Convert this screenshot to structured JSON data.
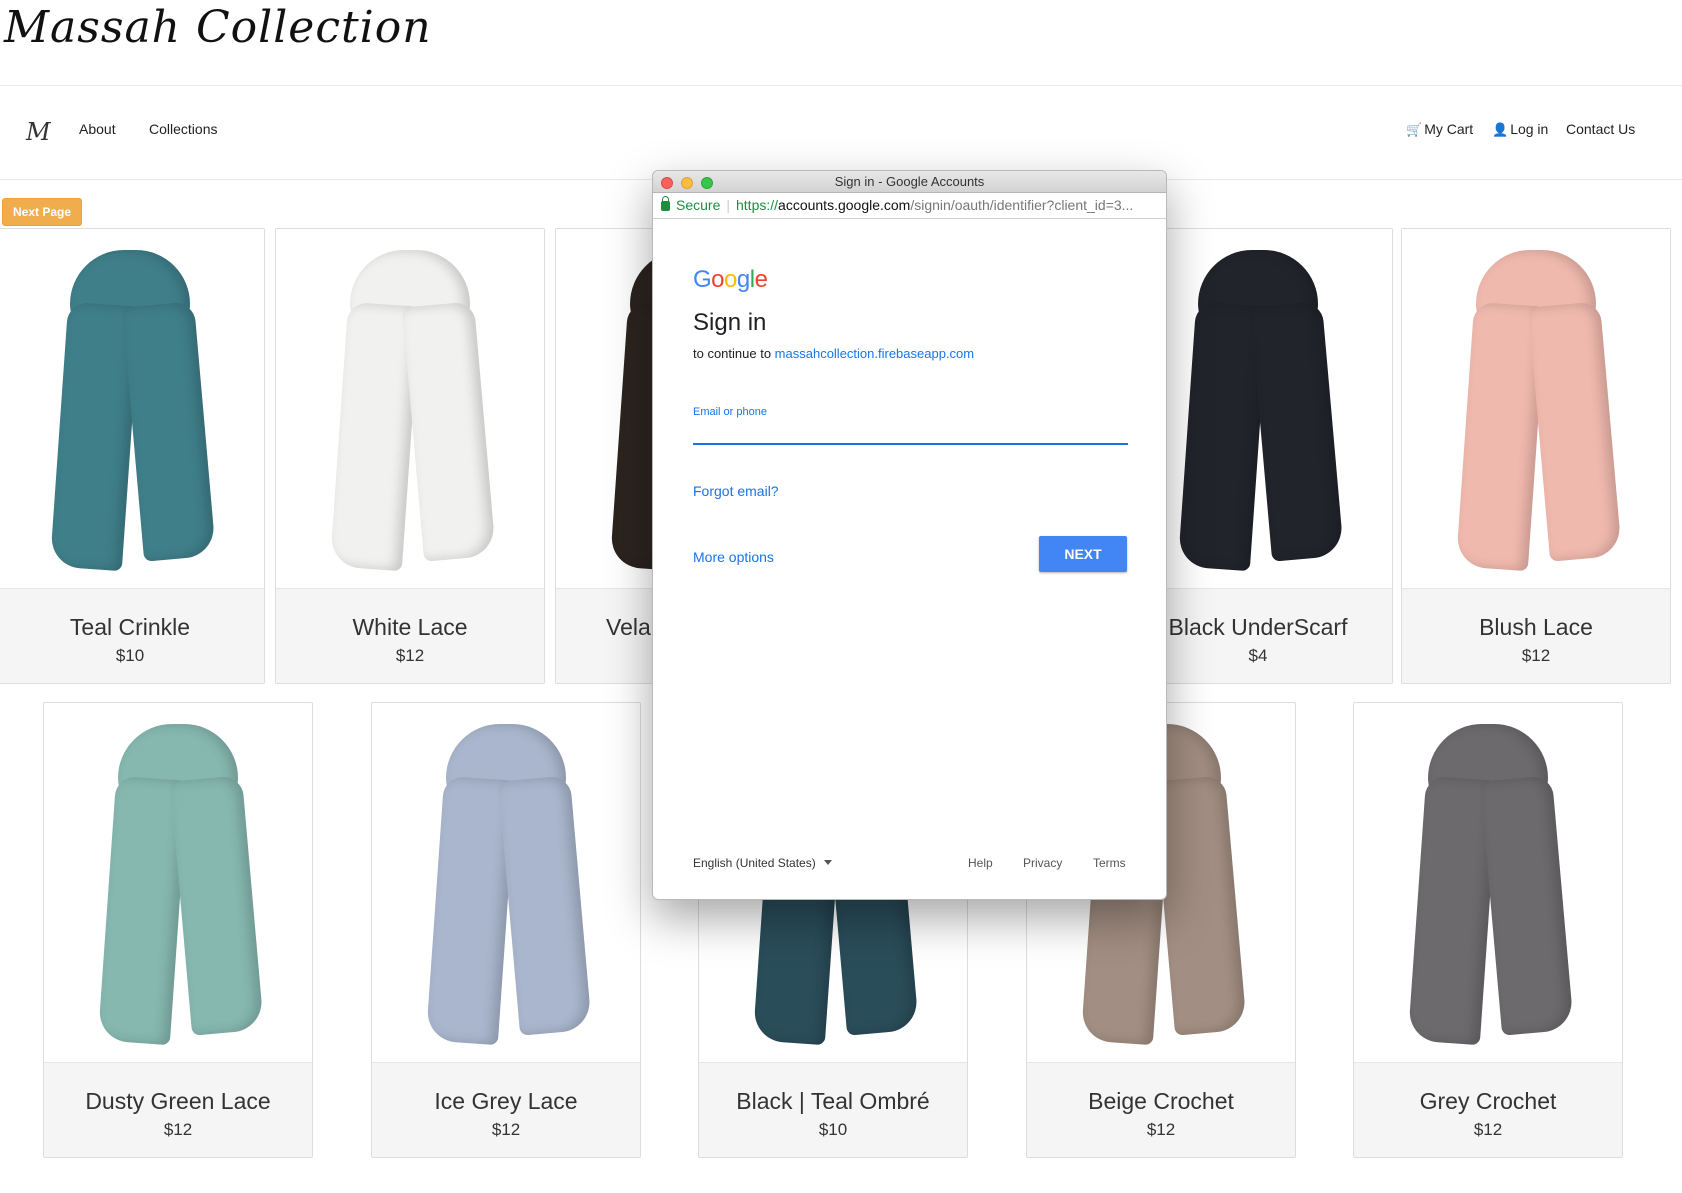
{
  "brand": {
    "logo_text": "Massah Collection",
    "monogram": "M"
  },
  "nav": {
    "about": "About",
    "collections": "Collections",
    "cart": "My Cart",
    "login": "Log in",
    "contact": "Contact Us"
  },
  "next_page_label": "Next Page",
  "products": [
    {
      "name": "Teal Crinkle",
      "price": "$10",
      "color": "#3f7f8a"
    },
    {
      "name": "White Lace",
      "price": "$12",
      "color": "#f1f1ef"
    },
    {
      "name": "Vela",
      "price": "",
      "color": "#2d241f"
    },
    {
      "name": "Black UnderScarf",
      "price": "$4",
      "color": "#22242c"
    },
    {
      "name": "Blush Lace",
      "price": "$12",
      "color": "#f0b9ae"
    },
    {
      "name": "Dusty Green Lace",
      "price": "$12",
      "color": "#86b8b0"
    },
    {
      "name": "Ice Grey Lace",
      "price": "$12",
      "color": "#a9b6cd"
    },
    {
      "name": "Black | Teal Ombré",
      "price": "$10",
      "color": "#2a4d5a"
    },
    {
      "name": "Beige Crochet",
      "price": "$12",
      "color": "#a28e82"
    },
    {
      "name": "Grey Crochet",
      "price": "$12",
      "color": "#6c6a6d"
    }
  ],
  "popup": {
    "window_title": "Sign in - Google Accounts",
    "secure_label": "Secure",
    "url_proto": "https://",
    "url_host": "accounts.google.com",
    "url_path": "/signin/oauth/identifier?client_id=3...",
    "heading": "Sign in",
    "subtitle_prefix": "to continue to ",
    "subtitle_link": "massahcollection.firebaseapp.com",
    "email_label": "Email or phone",
    "email_value": "",
    "forgot_email": "Forgot email?",
    "more_options": "More options",
    "next_label": "NEXT",
    "language": "English (United States)",
    "help": "Help",
    "privacy": "Privacy",
    "terms": "Terms"
  }
}
